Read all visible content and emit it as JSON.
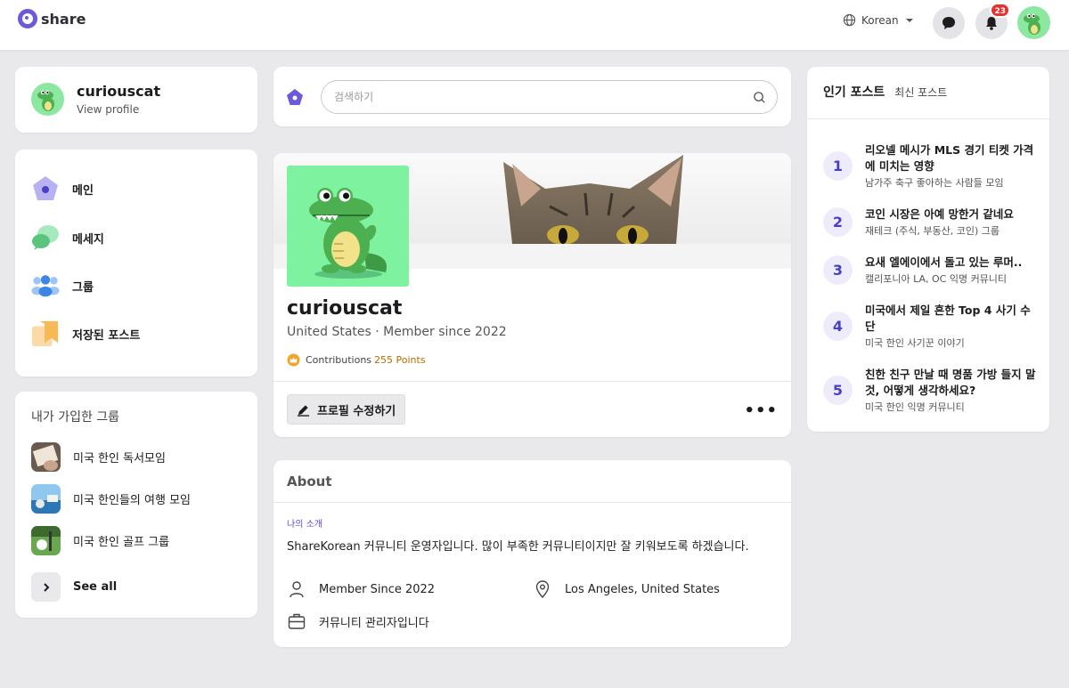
{
  "header": {
    "logo_text": "share",
    "language": "Korean",
    "notification_count": "23",
    "colors": {
      "brand": "#6b5bd9",
      "badge": "#e5322d"
    }
  },
  "user_card": {
    "name": "curiouscat",
    "link": "View profile"
  },
  "nav": {
    "items": [
      {
        "label": "메인",
        "icon": "home-pentagon-icon"
      },
      {
        "label": "메세지",
        "icon": "chat-bubbles-icon"
      },
      {
        "label": "그룹",
        "icon": "people-group-icon"
      },
      {
        "label": "저장된 포스트",
        "icon": "saved-posts-icon"
      }
    ]
  },
  "groups": {
    "title": "내가 가입한 그룹",
    "items": [
      {
        "name": "미국 한인 독서모임"
      },
      {
        "name": "미국 한인들의 여행 모임"
      },
      {
        "name": "미국 한인 골프 그룹"
      }
    ],
    "see_all": "See all"
  },
  "search": {
    "placeholder": "검색하기"
  },
  "profile": {
    "name": "curiouscat",
    "meta": "United States · Member since 2022",
    "contrib_label": "Contributions",
    "contrib_points": "255 Points",
    "edit_label": "프로필 수정하기",
    "more": "•••"
  },
  "about": {
    "title": "About",
    "intro_label": "나의 소개",
    "intro": "ShareKorean 커뮤니티 운영자입니다. 많이 부족한 커뮤니티이지만 잘 키워보도록 하겠습니다.",
    "member_since": "Member Since 2022",
    "location": "Los Angeles, United States",
    "role": "커뮤니티 관리자입니다"
  },
  "trending": {
    "tab_popular": "인기 포스트",
    "tab_latest": "최신 포스트",
    "items": [
      {
        "rank": "1",
        "title": " 리오넬 메시가 MLS 경기 티켓 가격에 미치는 영향",
        "group": "남가주 축구 좋아하는 사람들 모임"
      },
      {
        "rank": "2",
        "title": "코인 시장은 아예 망한거 같네요",
        "group": "재테크 (주식, 부동산, 코인) 그룹"
      },
      {
        "rank": "3",
        "title": "요새 엘에이에서 돌고 있는 루머..",
        "group": "캘리포니아 LA, OC 익명 커뮤니티"
      },
      {
        "rank": "4",
        "title": "미국에서 제일 흔한 Top 4 사기 수단",
        "group": "미국 한인 사기꾼 이야기"
      },
      {
        "rank": "5",
        "title": "친한 친구 만날 때 명품 가방 들지 말것, 어떻게 생각하세요?",
        "group": "미국 한인 익명 커뮤니티"
      }
    ]
  }
}
